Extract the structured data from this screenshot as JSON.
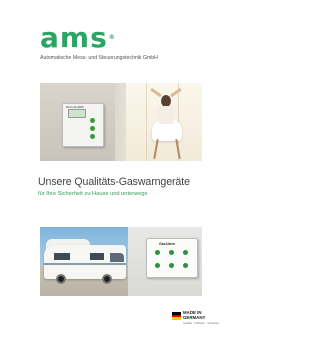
{
  "header": {
    "logo_text": "ams",
    "logo_registered": "®",
    "company_name": "Automatische Mess- und Steuerungstechnik GmbH"
  },
  "device1": {
    "label": "DUO ALARM",
    "buttons": [
      "",
      "",
      ""
    ]
  },
  "headline": {
    "title": "Unsere Qualitäts-Gaswarngeräte",
    "subtitle": "für Ihre Sicherheit zu Hause und unterwegs"
  },
  "device2": {
    "title": "GasAlarm",
    "labels": [
      "",
      "",
      "",
      "",
      "",
      ""
    ]
  },
  "badge": {
    "made_in": "MADE IN",
    "country": "GERMANY",
    "sub": "Qualität · Präzision · Sicherheit"
  },
  "colors": {
    "brand_green": "#2aa564",
    "subtitle_green": "#3a9a55",
    "flag_black": "#000000",
    "flag_red": "#dd0000",
    "flag_gold": "#ffce00"
  }
}
